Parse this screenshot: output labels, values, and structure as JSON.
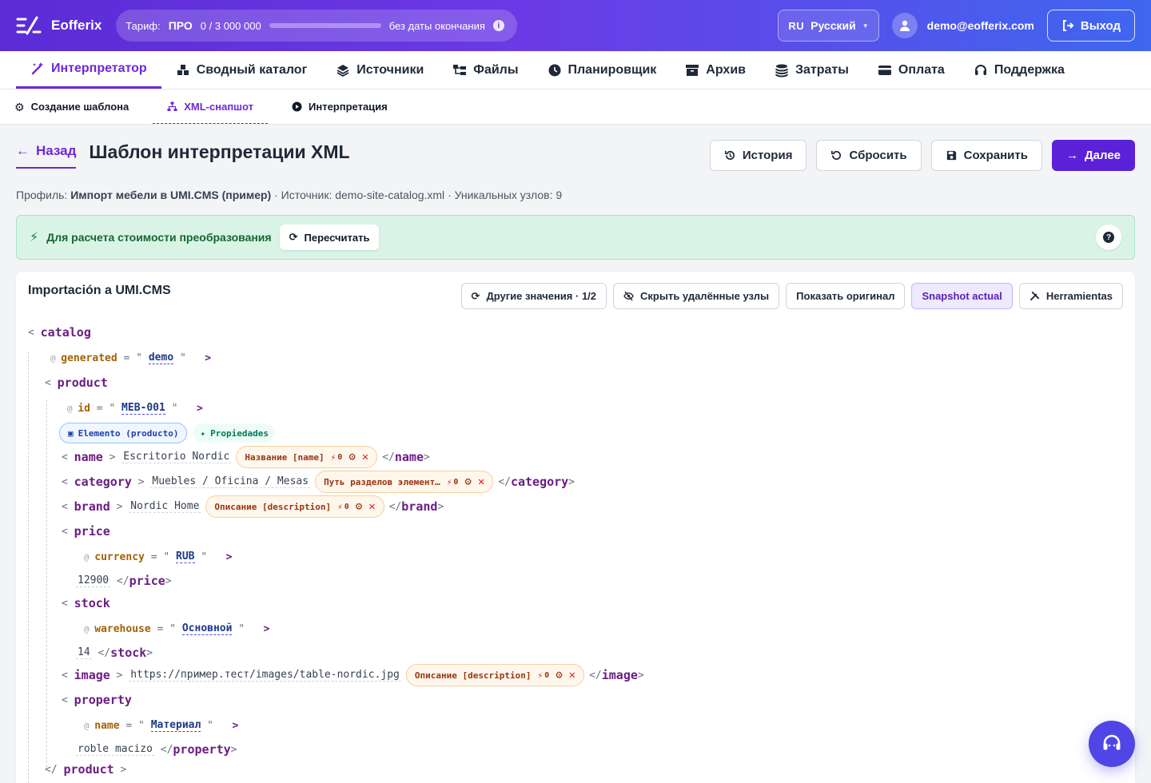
{
  "topbar": {
    "brand": "Eofferix",
    "plan_label": "Тариф:",
    "plan_name": "ПРО",
    "usage": "0 / 3 000 000",
    "usage_fraction": 0,
    "expiry": "без даты окончания",
    "lang_code": "RU",
    "lang_name": "Русский",
    "user_email": "demo@eofferix.com",
    "logout_label": "Выход"
  },
  "mainnav": [
    {
      "label": "Интерпретатор",
      "icon": "magic-wand-icon",
      "active": true
    },
    {
      "label": "Сводный каталог",
      "icon": "cubes-icon"
    },
    {
      "label": "Источники",
      "icon": "layers-icon"
    },
    {
      "label": "Файлы",
      "icon": "folder-tree-icon"
    },
    {
      "label": "Планировщик",
      "icon": "clock-icon"
    },
    {
      "label": "Архив",
      "icon": "archive-icon"
    },
    {
      "label": "Затраты",
      "icon": "coins-icon"
    },
    {
      "label": "Оплата",
      "icon": "card-icon"
    },
    {
      "label": "Поддержка",
      "icon": "headset-icon"
    }
  ],
  "subnav": [
    {
      "label": "Создание шаблона",
      "icon": "gear-icon"
    },
    {
      "label": "XML-снапшот",
      "icon": "sitemap-icon",
      "active": true
    },
    {
      "label": "Интерпретация",
      "icon": "play-circle-icon"
    }
  ],
  "page": {
    "back_label": "Назад",
    "title": "Шаблон интерпретации XML",
    "actions": {
      "history": "История",
      "reset": "Сбросить",
      "save": "Сохранить",
      "next": "Далее"
    },
    "meta": {
      "profile_label": "Профиль:",
      "profile_name": "Импорт мебели в UMI.CMS (пример)",
      "source_label": "· Источник:",
      "source_name": "demo-site-catalog.xml",
      "nodes_label": "· Уникальных узлов:",
      "nodes_count": "9"
    }
  },
  "alert": {
    "text": "Для расчета стоимости преобразования",
    "recalc": "Пересчитать",
    "help": "?"
  },
  "card": {
    "title": "Importación a UMI.CMS",
    "tools": {
      "other_values": "Другие значения · 1/2",
      "hide_deleted": "Скрыть удалённые узлы",
      "show_original": "Показать оригинал",
      "snapshot": "Snapshot actual",
      "tools": "Herramientas"
    }
  },
  "xml": {
    "catalog": "catalog",
    "generated_attr": "generated",
    "generated_val": "demo",
    "product": "product",
    "id_attr": "id",
    "id_val": "MEB-001",
    "element_badge": "Elemento (producto)",
    "props_badge": "Propiedades",
    "name_tag": "name",
    "name_text": "Escritorio Nordic",
    "name_chip": "Название [name]",
    "category_tag": "category",
    "category_text": "Muebles / Oficina / Mesas",
    "category_chip": "Путь разделов элемент…",
    "brand_tag": "brand",
    "brand_text": "Nordic Home",
    "brand_chip": "Описание [description]",
    "price_tag": "price",
    "currency_attr": "currency",
    "currency_val": "RUB",
    "price_text": "12900",
    "stock_tag": "stock",
    "warehouse_attr": "warehouse",
    "warehouse_val": "Основной",
    "stock_text": "14",
    "image_tag": "image",
    "image_text": "https://пример.тест/images/table-nordic.jpg",
    "image_chip": "Описание [description]",
    "property_tag": "property",
    "pname_attr": "name",
    "pname_val": "Материал",
    "property_text": "roble macizo",
    "chip_count": "0"
  }
}
